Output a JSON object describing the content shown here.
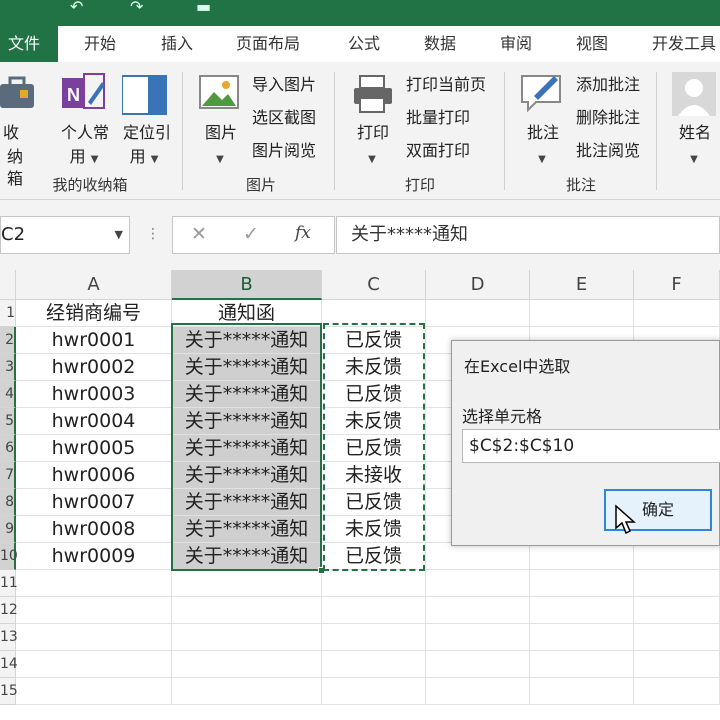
{
  "ribbon": {
    "tabs": [
      "文件",
      "开始",
      "插入",
      "页面布局",
      "公式",
      "数据",
      "审阅",
      "视图",
      "开发工具"
    ],
    "groups": {
      "collection": {
        "label": "我的收纳箱",
        "btn_shoucang_top": "收",
        "btn_shoucang_bottom": "纳箱",
        "btn_geren_top": "个人常",
        "btn_geren_bottom": "用",
        "btn_dingwei_top": "定位引",
        "btn_dingwei_bottom": "用"
      },
      "picture": {
        "label": "图片",
        "big_button": "图片",
        "small_buttons": [
          "导入图片",
          "选区截图",
          "图片阅览"
        ]
      },
      "print": {
        "label": "打印",
        "big_button": "打印",
        "small_buttons": [
          "打印当前页",
          "批量打印",
          "双面打印"
        ]
      },
      "comment": {
        "label": "批注",
        "big_button": "批注",
        "small_buttons": [
          "添加批注",
          "删除批注",
          "批注阅览"
        ]
      },
      "name": {
        "big_button": "姓名"
      }
    }
  },
  "formula_bar": {
    "name_box": "C2",
    "cancel_glyph": "✕",
    "enter_glyph": "✓",
    "fx_glyph": "fx",
    "formula": "关于*****通知"
  },
  "sheet": {
    "columns": [
      "A",
      "B",
      "C",
      "D",
      "E",
      "F"
    ],
    "rows": [
      {
        "num": "1",
        "a": "经销商编号",
        "b": "通知函",
        "c": ""
      },
      {
        "num": "2",
        "a": "hwr0001",
        "b": "关于*****通知",
        "c": "已反馈"
      },
      {
        "num": "3",
        "a": "hwr0002",
        "b": "关于*****通知",
        "c": "未反馈"
      },
      {
        "num": "4",
        "a": "hwr0003",
        "b": "关于*****通知",
        "c": "已反馈"
      },
      {
        "num": "5",
        "a": "hwr0004",
        "b": "关于*****通知",
        "c": "未反馈"
      },
      {
        "num": "6",
        "a": "hwr0005",
        "b": "关于*****通知",
        "c": "已反馈"
      },
      {
        "num": "7",
        "a": "hwr0006",
        "b": "关于*****通知",
        "c": "未接收"
      },
      {
        "num": "8",
        "a": "hwr0007",
        "b": "关于*****通知",
        "c": "已反馈"
      },
      {
        "num": "9",
        "a": "hwr0008",
        "b": "关于*****通知",
        "c": "未反馈"
      },
      {
        "num": "10",
        "a": "hwr0009",
        "b": "关于*****通知",
        "c": "已反馈"
      },
      {
        "num": "11",
        "a": "",
        "b": "",
        "c": ""
      },
      {
        "num": "12",
        "a": "",
        "b": "",
        "c": ""
      },
      {
        "num": "13",
        "a": "",
        "b": "",
        "c": ""
      },
      {
        "num": "14",
        "a": "",
        "b": "",
        "c": ""
      },
      {
        "num": "15",
        "a": "",
        "b": "",
        "c": ""
      }
    ]
  },
  "dialog": {
    "title": "在Excel中选取",
    "label": "选择单元格",
    "value": "$C$2:$C$10",
    "ok": "确定"
  },
  "colors": {
    "excel_green": "#217346",
    "selection_fill": "#cfcfcf",
    "button_border": "#2f86d8"
  }
}
